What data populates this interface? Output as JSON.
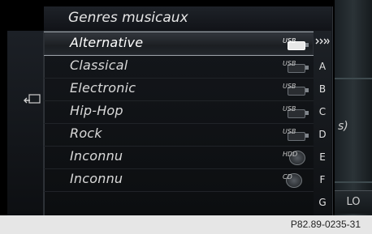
{
  "header": {
    "title": "Genres musicaux"
  },
  "rows": [
    {
      "label": "Alternative",
      "source": "USB",
      "icon": "usb-icon",
      "selected": true
    },
    {
      "label": "Classical",
      "source": "USB",
      "icon": "usb-icon"
    },
    {
      "label": "Electronic",
      "source": "USB",
      "icon": "usb-icon"
    },
    {
      "label": "Hip-Hop",
      "source": "USB",
      "icon": "usb-icon"
    },
    {
      "label": "Rock",
      "source": "USB",
      "icon": "usb-icon"
    },
    {
      "label": "Inconnu",
      "source": "HDD",
      "icon": "hdd-icon"
    },
    {
      "label": "Inconnu",
      "source": "CD",
      "icon": "cd-icon"
    }
  ],
  "alphabet": [
    "A",
    "B",
    "C",
    "D",
    "E",
    "F",
    "G"
  ],
  "right_panel": {
    "partial_text": "s)",
    "lo_label": "LO"
  },
  "footer": {
    "reference": "P82.89-0235-31"
  }
}
